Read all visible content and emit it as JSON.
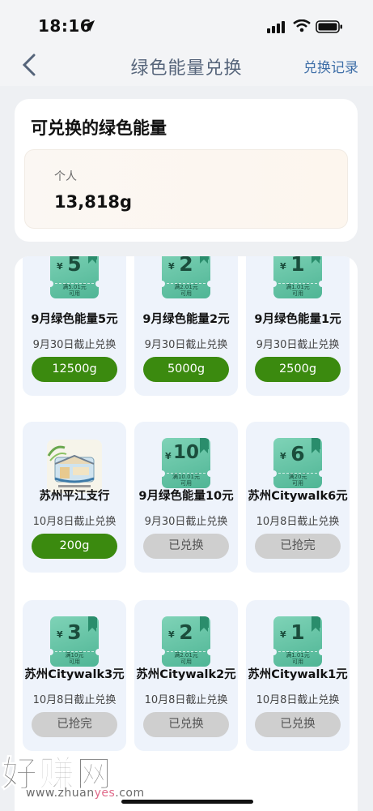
{
  "status": {
    "time": "18:16"
  },
  "nav": {
    "title": "绿色能量兑换",
    "right_link": "兑换记录"
  },
  "energy": {
    "title": "可兑换的绿色能量",
    "personal_label": "个人",
    "personal_value": "13,818g"
  },
  "rewards": [
    {
      "kind": "coupon",
      "amount": "5",
      "yen": "¥",
      "condition": "满5.01元\n可用",
      "name": "9月绿色能量5元",
      "deadline": "9月30日截止兑换",
      "button": "12500g",
      "state": "available"
    },
    {
      "kind": "coupon",
      "amount": "2",
      "yen": "¥",
      "condition": "满2.01元\n可用",
      "name": "9月绿色能量2元",
      "deadline": "9月30日截止兑换",
      "button": "5000g",
      "state": "available"
    },
    {
      "kind": "coupon",
      "amount": "1",
      "yen": "¥",
      "condition": "满1.01元\n可用",
      "name": "9月绿色能量1元",
      "deadline": "9月30日截止兑换",
      "button": "2500g",
      "state": "available"
    },
    {
      "kind": "product",
      "name": "苏州平江支行",
      "deadline": "10月8日截止兑换",
      "button": "200g",
      "state": "available"
    },
    {
      "kind": "coupon",
      "amount": "10",
      "yen": "¥",
      "condition": "满10.01元\n可用",
      "name": "9月绿色能量10元",
      "deadline": "9月30日截止兑换",
      "button": "已兑换",
      "state": "redeemed"
    },
    {
      "kind": "coupon",
      "amount": "6",
      "yen": "¥",
      "condition": "满20元\n可用",
      "name": "苏州Citywalk6元",
      "deadline": "10月8日截止兑换",
      "button": "已抢完",
      "state": "soldout"
    },
    {
      "kind": "coupon",
      "amount": "3",
      "yen": "¥",
      "condition": "满10元\n可用",
      "name": "苏州Citywalk3元",
      "deadline": "10月8日截止兑换",
      "button": "已抢完",
      "state": "soldout"
    },
    {
      "kind": "coupon",
      "amount": "2",
      "yen": "¥",
      "condition": "满2.01元\n可用",
      "name": "苏州Citywalk2元",
      "deadline": "10月8日截止兑换",
      "button": "已兑换",
      "state": "redeemed"
    },
    {
      "kind": "coupon",
      "amount": "1",
      "yen": "¥",
      "condition": "满1.01元\n可用",
      "name": "苏州Citywalk1元",
      "deadline": "10月8日截止兑换",
      "button": "已兑换",
      "state": "redeemed"
    }
  ],
  "watermark": {
    "text": "好赚网",
    "url_pre": "www.zhuan",
    "url_hl": "yes",
    "url_post": ".com"
  },
  "colors": {
    "primary_green": "#3b8a0f",
    "link_blue": "#3f6fa8",
    "coupon_teal": "#5bbf9e"
  },
  "icons": [
    "location-arrow-icon",
    "signal-icon",
    "wifi-icon",
    "battery-icon",
    "back-chevron-icon",
    "ribbon-icon"
  ]
}
